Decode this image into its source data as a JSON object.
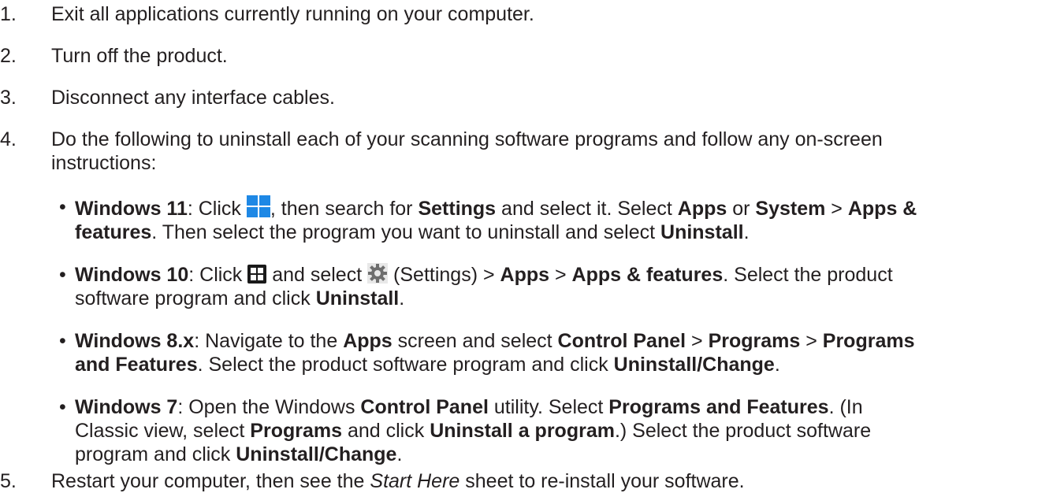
{
  "steps": [
    {
      "num": "1.",
      "text": "Exit all applications currently running on your computer."
    },
    {
      "num": "2.",
      "text": "Turn off the product."
    },
    {
      "num": "3.",
      "text": "Disconnect any interface cables."
    },
    {
      "num": "4.",
      "text_line1": "Do the following to uninstall each of your scanning software programs and follow any on-screen",
      "text_line2": "instructions:"
    },
    {
      "num": "5.",
      "pre": "Restart your computer, then see the ",
      "italic": "Start Here",
      "post": " sheet to re-install your software."
    }
  ],
  "bullets": {
    "glyph": "•",
    "win11": {
      "os": "Windows 11",
      "t1": ": Click ",
      "icon": "windows-11-start-icon",
      "t2": ", then search for ",
      "settings": "Settings",
      "t3": " and select it. Select ",
      "apps": "Apps",
      "t4": " or ",
      "system": "System",
      "t5": " > ",
      "apps_features_a": "Apps &",
      "apps_features_b": "features",
      "t6": ". Then select the program you want to uninstall and select ",
      "uninstall": "Uninstall",
      "t7": "."
    },
    "win10": {
      "os": "Windows 10",
      "t1": ": Click ",
      "icon_start": "windows-10-start-icon",
      "t2": " and select ",
      "icon_gear": "settings-gear-icon",
      "t3": " (Settings) > ",
      "apps": "Apps",
      "t4": " > ",
      "apps_features": "Apps & features",
      "t5": ". Select the product",
      "t6": "software program and click ",
      "uninstall": "Uninstall",
      "t7": "."
    },
    "win8": {
      "os": "Windows 8.x",
      "t1": ": Navigate to the ",
      "apps": "Apps",
      "t2": " screen and select ",
      "control_panel": "Control Panel",
      "t3": " > ",
      "programs": "Programs",
      "t4": " > ",
      "programs_b": "Programs",
      "and_features": "and Features",
      "t5": ". Select the product software program and click ",
      "uninstall_change": "Uninstall/Change",
      "t6": "."
    },
    "win7": {
      "os": "Windows 7",
      "t1": ": Open the Windows ",
      "control_panel": "Control Panel",
      "t2": " utility. Select ",
      "programs_features": "Programs and Features",
      "t3": ". (In",
      "t4": "Classic view, select ",
      "programs": "Programs",
      "t5": " and click ",
      "uninstall_program": "Uninstall a program",
      "t6": ".) Select the product software",
      "t7": "program and click ",
      "uninstall_change": "Uninstall/Change",
      "t8": "."
    }
  },
  "colors": {
    "text": "#231f20",
    "win11_blue": "#1e88e5",
    "win10_dark": "#1a1a1a"
  }
}
